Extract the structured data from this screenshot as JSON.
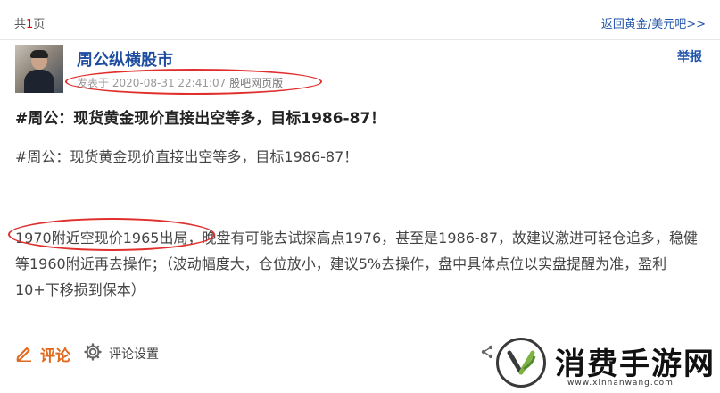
{
  "header": {
    "pages_prefix": "共",
    "pages_num": "1",
    "pages_suffix": "页",
    "back_link": "返回黄金/美元吧>>"
  },
  "post": {
    "author": "周公纵横股市",
    "report_label": "举报",
    "posted_prefix": "发表于",
    "posted_time": "2020-08-31 22:41:07",
    "source": "股吧网页版",
    "title": "#周公：现货黄金现价直接出空等多，目标1986-87！",
    "paragraph1": "#周公：现货黄金现价直接出空等多，目标1986-87！",
    "paragraph2": "1970附近空现价1965出局，晚盘有可能去试探高点1976，甚至是1986-87，故建议激进可轻仓追多，稳健等1960附近再去操作；（波动幅度大，仓位放小，建议5%去操作，盘中具体点位以实盘提醒为准，盈利10+下移损到保本）"
  },
  "footer": {
    "comment_label": "评论",
    "settings_label": "评论设置"
  },
  "watermark": {
    "title": "消费手游网",
    "url": "www.xinnanwang.com"
  },
  "colors": {
    "link": "#2255aa",
    "author": "#1f4ea1",
    "annotation": "#e0302e",
    "comment": "#e06a1e"
  }
}
